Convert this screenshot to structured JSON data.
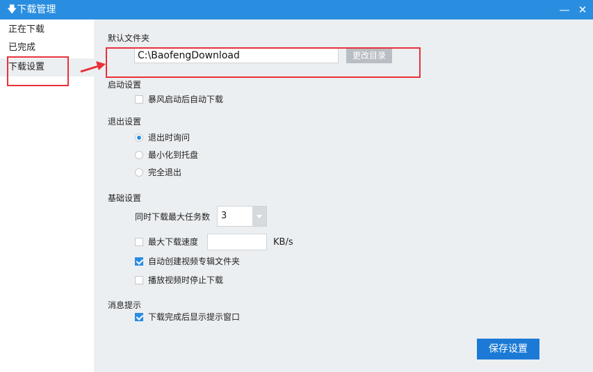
{
  "window": {
    "title": "下载管理",
    "title_icon": "download-arrow-icon",
    "minimize_glyph": "—",
    "close_glyph": "✕"
  },
  "sidebar": {
    "items": [
      {
        "label": "正在下载",
        "active": false
      },
      {
        "label": "已完成",
        "active": false
      },
      {
        "label": "下载设置",
        "active": true
      }
    ]
  },
  "settings": {
    "default_folder": {
      "label": "默认文件夹",
      "path": "C:\\BaofengDownload",
      "change_button": "更改目录"
    },
    "startup": {
      "label": "启动设置",
      "options": [
        {
          "label": "暴风启动后自动下载",
          "checked": false
        }
      ]
    },
    "exit": {
      "label": "退出设置",
      "options": [
        {
          "label": "退出时询问",
          "selected": true
        },
        {
          "label": "最小化到托盘",
          "selected": false
        },
        {
          "label": "完全退出",
          "selected": false
        }
      ]
    },
    "basic": {
      "label": "基础设置",
      "max_tasks_label": "同时下载最大任务数",
      "max_tasks_value": "3",
      "max_speed_label": "最大下载速度",
      "max_speed_checked": false,
      "max_speed_value": "",
      "max_speed_unit": "KB/s",
      "auto_album": {
        "label": "自动创建视频专辑文件夹",
        "checked": true
      },
      "stop_on_play": {
        "label": "播放视频时停止下载",
        "checked": false
      }
    },
    "notify": {
      "label": "消息提示",
      "options": [
        {
          "label": "下载完成后显示提示窗口",
          "checked": true
        }
      ]
    },
    "save_button": "保存设置"
  },
  "colors": {
    "titlebar": "#2a8ee0",
    "accent": "#1c7ad6",
    "annotation": "#e8303a",
    "panel_bg": "#eceff1"
  }
}
